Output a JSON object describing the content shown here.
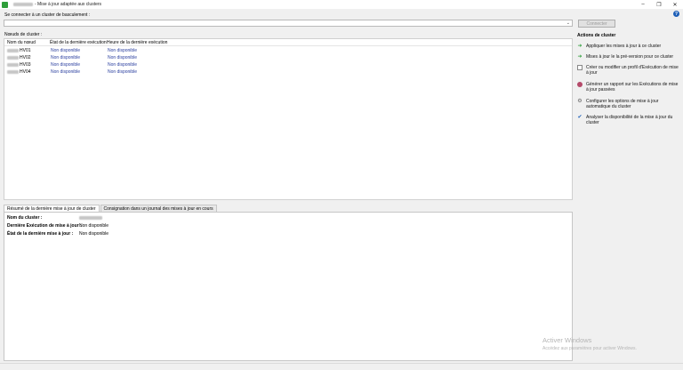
{
  "window": {
    "title": "- Mise à jour adaptée aux clusters",
    "minimize": "–",
    "maximize": "❐",
    "close": "✕"
  },
  "help": {
    "icon": "help-icon",
    "label": "?"
  },
  "connect": {
    "label": "Se connecter à un cluster de basculement :",
    "button": "Connecter",
    "arrow": "⌄"
  },
  "nodes": {
    "label": "Nœuds de cluster :",
    "columns": [
      "Nom du nœud",
      "État de la dernière exécution",
      "Heure de la dernière exécution"
    ],
    "rows": [
      {
        "name": "HV01",
        "state": "Non disponible",
        "time": "Non disponible"
      },
      {
        "name": "HV02",
        "state": "Non disponible",
        "time": "Non disponible"
      },
      {
        "name": "HV03",
        "state": "Non disponible",
        "time": "Non disponible"
      },
      {
        "name": "HV04",
        "state": "Non disponible",
        "time": "Non disponible"
      }
    ]
  },
  "actions": {
    "title": "Actions de cluster",
    "items": [
      {
        "icon": "play-icon",
        "glyph": "➜",
        "label": "Appliquer les mises à jour à ce cluster"
      },
      {
        "icon": "preview-arrow-icon",
        "glyph": "➜",
        "label": "Mises à jour le la pré-version pour ce cluster"
      },
      {
        "icon": "profile-document-icon",
        "glyph": "",
        "label": "Créer ou modifier un profil d'Exécution de mise à jour"
      },
      {
        "icon": "report-icon",
        "glyph": "",
        "label": "Générer un rapport sur les Exécutions de mise à jour passées"
      },
      {
        "icon": "gear-icon",
        "glyph": "⚙",
        "label": "Configurer les options de mise à jour automatique du cluster"
      },
      {
        "icon": "checkmark-icon",
        "glyph": "✔",
        "label": "Analyser la disponibilité de la mise à jour du cluster"
      }
    ]
  },
  "tabs": [
    {
      "label": "Résumé de la dernière mise à jour de cluster",
      "active": true
    },
    {
      "label": "Consignation dans un journal des mises à jour en cours",
      "active": false
    }
  ],
  "summary": {
    "cluster_name_label": "Nom du cluster :",
    "last_run_label": "Dernière Exécution de mise à jour :",
    "last_run_value": "Non disponible",
    "last_state_label": "État de la dernière mise à jour :",
    "last_state_value": "Non disponible"
  },
  "watermark": {
    "line1": "Activer Windows",
    "line2": "Accédez aux paramètres pour activer Windows."
  }
}
